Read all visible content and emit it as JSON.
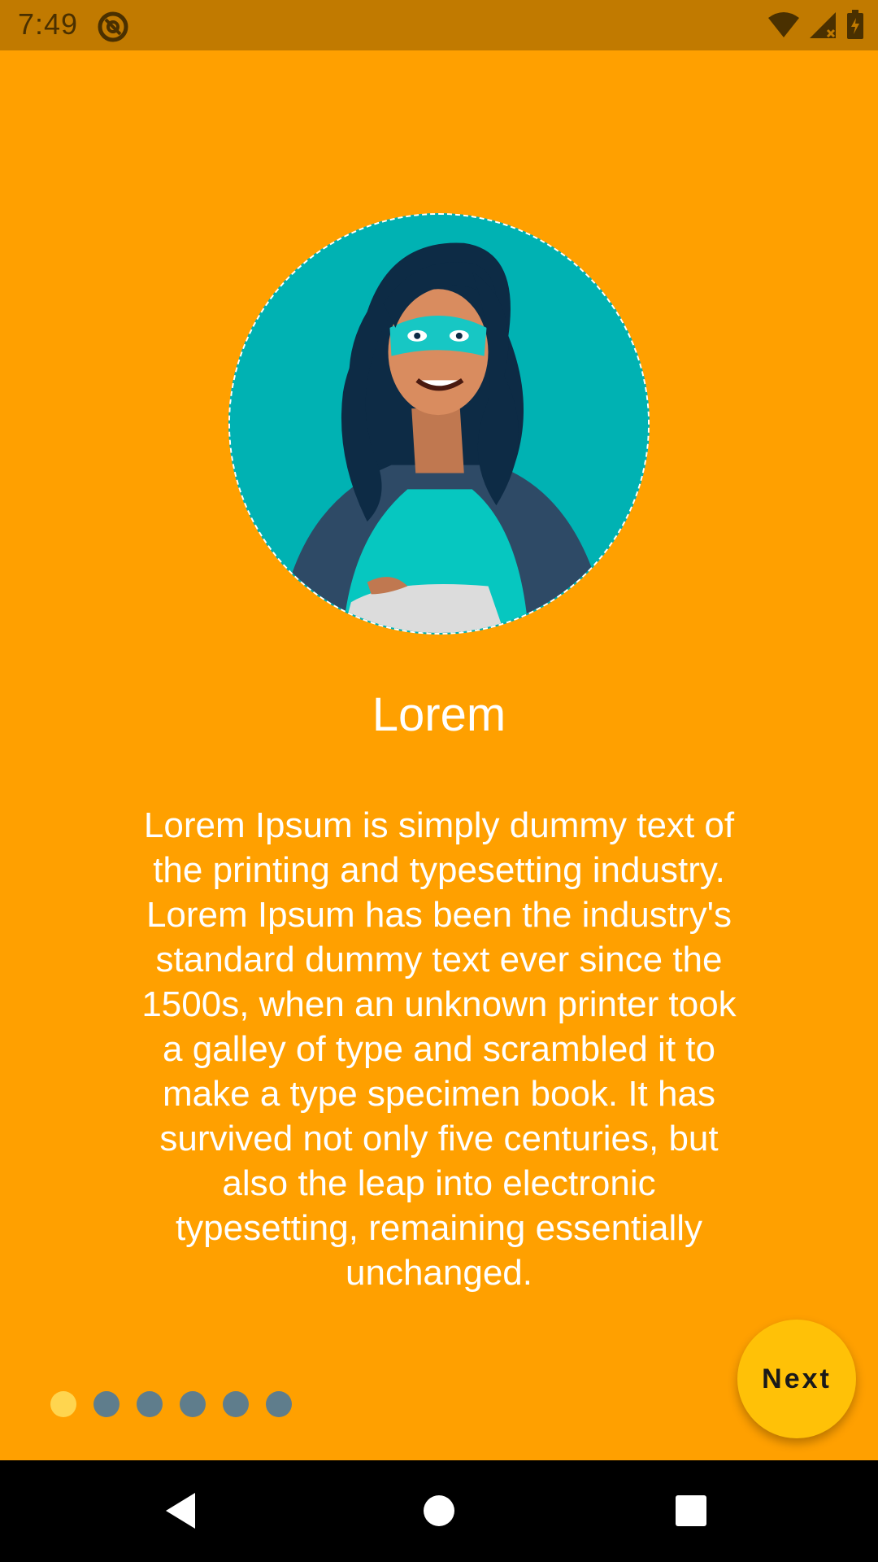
{
  "status_bar": {
    "time": "7:49",
    "icons": [
      "app-notification-icon",
      "wifi-icon",
      "signal-icon",
      "battery-charging-icon"
    ]
  },
  "onboarding": {
    "illustration": "woman-avatar-illustration",
    "title": "Lorem",
    "description": "Lorem Ipsum is simply dummy text of the printing and typesetting industry. Lorem Ipsum has been the industry's standard dummy text ever since the 1500s, when an unknown printer took a galley of type and scrambled it to make a type specimen book. It has survived not only five centuries, but also the leap into electronic typesetting, remaining essentially unchanged.",
    "page_indicator": {
      "total": 6,
      "current": 1
    },
    "next_label": "Next"
  },
  "navigation_bar": {
    "icons": [
      "back-icon",
      "home-icon",
      "recents-icon"
    ]
  },
  "colors": {
    "background": "#ffa000",
    "status_bar": "#c17a00",
    "fab": "#ffc107",
    "dot_active": "#ffd54f",
    "dot_inactive": "#5f7d8c"
  }
}
